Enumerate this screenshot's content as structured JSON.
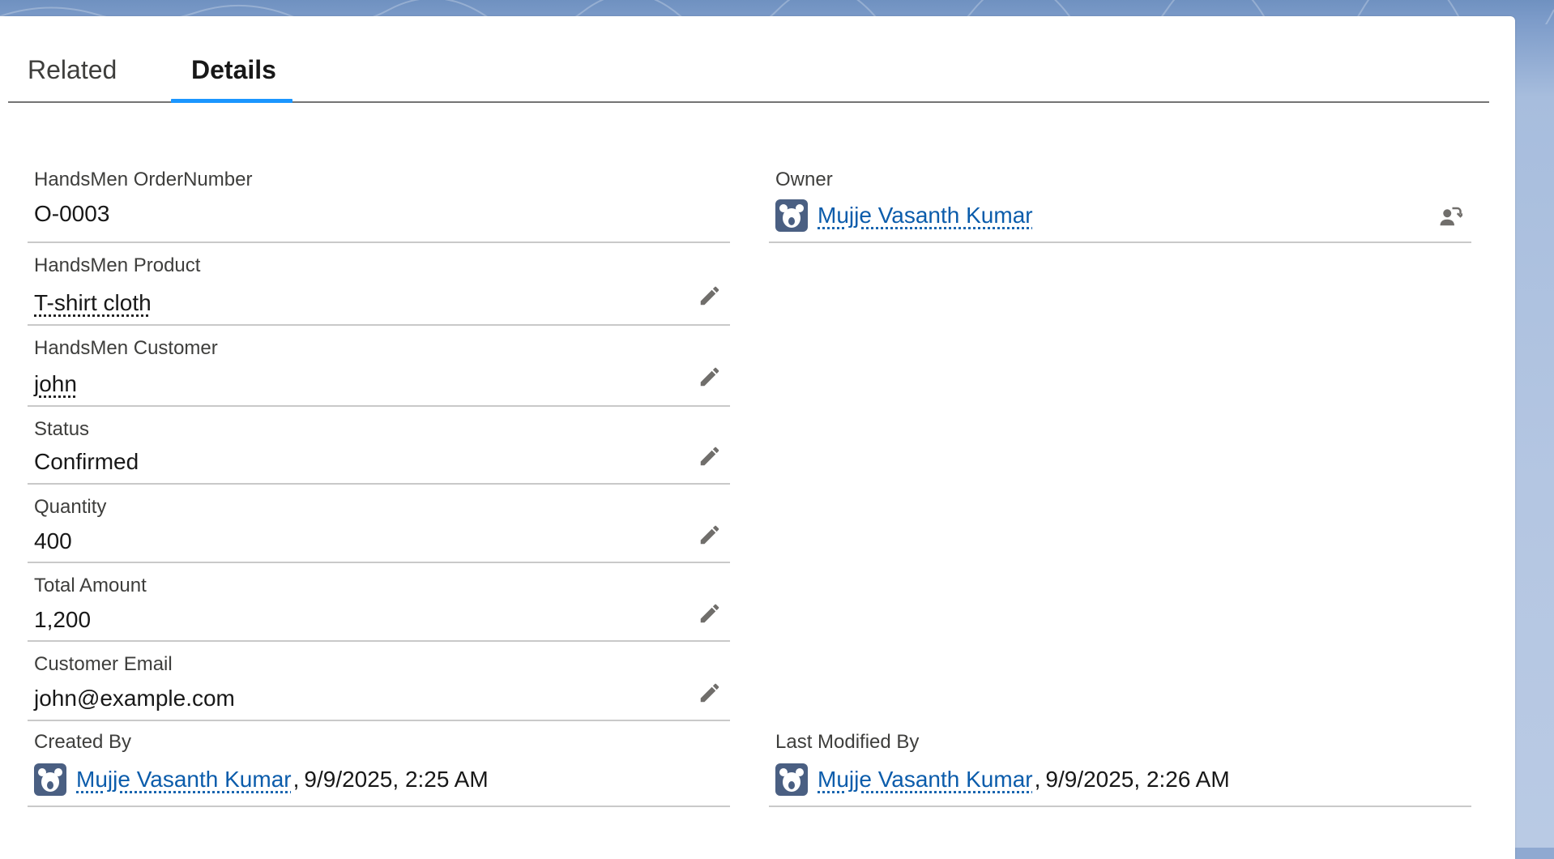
{
  "tabs": {
    "related": "Related",
    "details": "Details"
  },
  "fields": {
    "order_number": {
      "label": "HandsMen OrderNumber",
      "value": "O-0003"
    },
    "product": {
      "label": "HandsMen Product",
      "value": "T-shirt cloth"
    },
    "customer": {
      "label": "HandsMen Customer",
      "value": "john"
    },
    "status": {
      "label": "Status",
      "value": "Confirmed"
    },
    "quantity": {
      "label": "Quantity",
      "value": "400"
    },
    "total_amount": {
      "label": "Total Amount",
      "value": "1,200"
    },
    "customer_email": {
      "label": "Customer Email",
      "value": "john@example.com"
    },
    "created_by": {
      "label": "Created By",
      "user": "Mujje Vasanth Kumar",
      "timestamp": "9/9/2025, 2:25 AM"
    },
    "owner": {
      "label": "Owner",
      "user": "Mujje Vasanth Kumar"
    },
    "last_modified_by": {
      "label": "Last Modified By",
      "user": "Mujje Vasanth Kumar",
      "timestamp": "9/9/2025, 2:26 AM"
    }
  },
  "punctuation": {
    "comma": ","
  },
  "icons": {
    "edit": "pencil-icon",
    "avatar": "bear-avatar-icon",
    "change_owner": "change-owner-icon"
  },
  "colors": {
    "link": "#0b5cab",
    "tab_active": "#1b96ff",
    "avatar_bg": "#4a5f82"
  }
}
